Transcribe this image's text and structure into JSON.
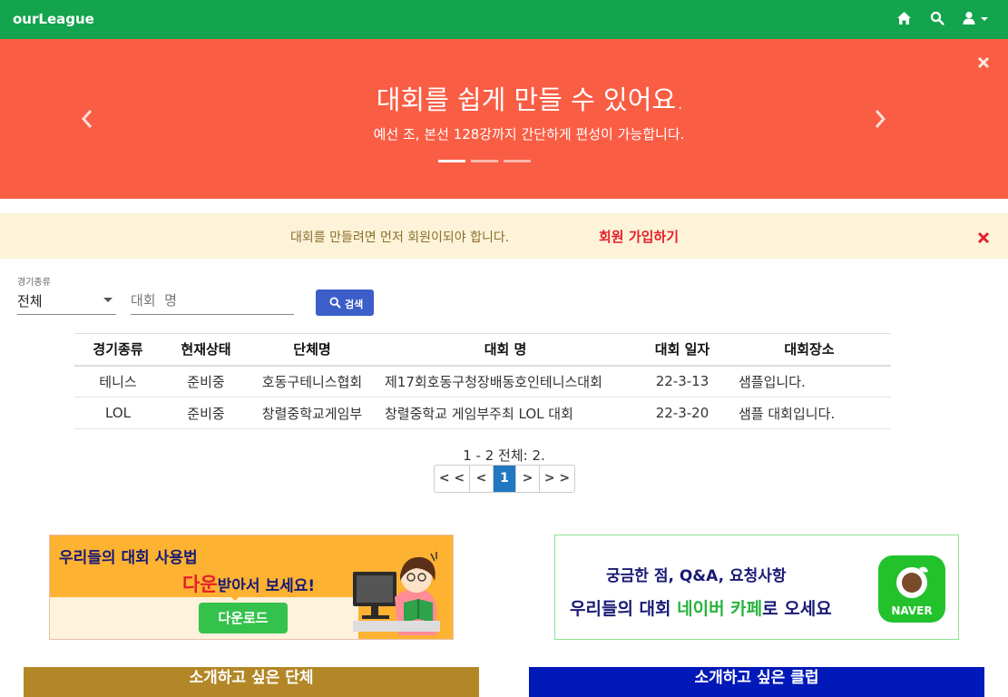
{
  "app": {
    "brand": "ourLeague"
  },
  "nav": {
    "icons": [
      "home-icon",
      "search-icon",
      "user-icon"
    ]
  },
  "colors": {
    "navbar": "#14a44d",
    "carousel": "#f95d44",
    "alert_bg": "#fcf3d8",
    "primary": "#3b5ec9",
    "page_active": "#1f78c1"
  },
  "carousel": {
    "title": "대회를 쉽게 만들 수 있어요.",
    "subtitle": "예선 조, 본선 128강까지 간단하게 편성이 가능합니다.",
    "slides": 3,
    "active_slide": 1
  },
  "alert": {
    "message": "대회를 만들려면 먼저 회원이되야 합니다.",
    "link": "회원 가입하기"
  },
  "search": {
    "category_label": "경기종류",
    "category_value": "전체",
    "name_placeholder": "대회  명",
    "name_value": "",
    "button_label": "검색"
  },
  "table": {
    "columns": [
      "경기종류",
      "현재상태",
      "단체명",
      "대회  명",
      "대회 일자",
      "대회장소"
    ],
    "rows": [
      [
        "테니스",
        "준비중",
        "호동구테니스협회",
        "제17회호동구청장배동호인테니스대회",
        "22-3-13",
        "샘플입니다."
      ],
      [
        "LOL",
        "준비중",
        "창렬중학교게임부",
        "창렬중학교 게임부주최 LOL 대회",
        "22-3-20",
        "샘플 대회입니다."
      ]
    ]
  },
  "pagination": {
    "summary": "1 - 2 전체: 2.",
    "buttons": [
      "< <",
      "<",
      "1",
      ">",
      "> >"
    ],
    "current": "1"
  },
  "banners": {
    "left": {
      "line1": "우리들의 대회  사용법",
      "line2_highlight": "다운",
      "line2_rest": "받아서 보세요!",
      "button": "다운로드"
    },
    "right": {
      "line1": "궁금한 점, Q&A, 요청사항",
      "line2_a": "우리들의 대회 ",
      "line2_b": "네이버 카페",
      "line2_c": "로 오세요",
      "badge": "NAVER"
    }
  },
  "intro": {
    "left": "소개하고 싶은 단체",
    "right": "소개하고 싶은 클럽"
  }
}
